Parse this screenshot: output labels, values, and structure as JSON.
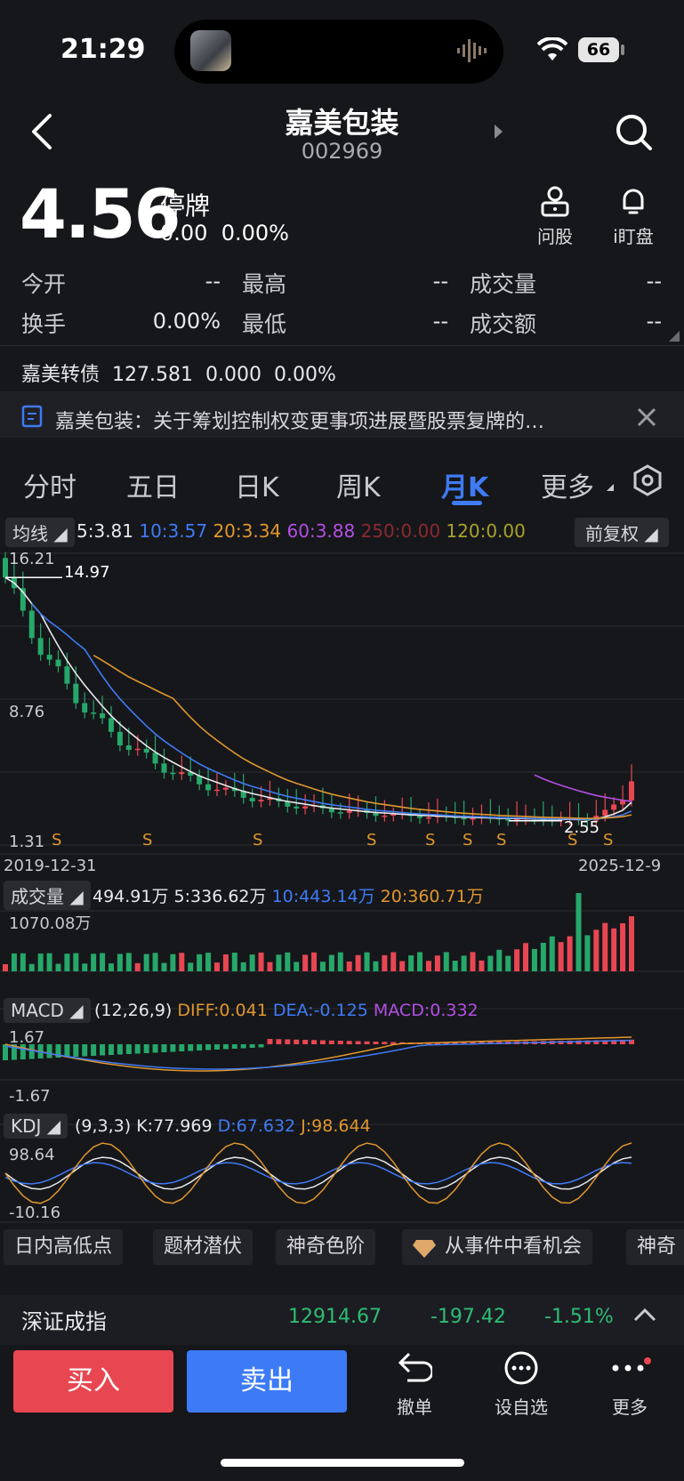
{
  "status": {
    "time": "21:29",
    "battery": "66"
  },
  "header": {
    "title": "嘉美包装",
    "code": "002969"
  },
  "quote": {
    "price": "4.56",
    "status": "停牌",
    "change": "0.00",
    "change_pct": "0.00%"
  },
  "tools": {
    "ask": "问股",
    "watch": "i盯盘"
  },
  "stats": {
    "open_label": "今开",
    "open": "--",
    "high_label": "最高",
    "high": "--",
    "vol_label": "成交量",
    "vol": "--",
    "turnover_label": "换手",
    "turnover": "0.00%",
    "low_label": "最低",
    "low": "--",
    "amount_label": "成交额",
    "amount": "--"
  },
  "bond": {
    "name": "嘉美转债",
    "price": "127.581",
    "change": "0.000",
    "pct": "0.00%"
  },
  "notice": {
    "text": "嘉美包装：关于筹划控制权变更事项进展暨股票复牌的…"
  },
  "tabs": [
    "分时",
    "五日",
    "日K",
    "周K",
    "月K",
    "更多"
  ],
  "active_tab": "月K",
  "ma": {
    "pill": "均线",
    "ma5": "5:3.81",
    "ma10": "10:3.57",
    "ma20": "20:3.34",
    "ma60": "60:3.88",
    "ma250": "250:0.00",
    "ma120": "120:0.00",
    "adjust": "前复权"
  },
  "price_axis": {
    "top": "16.21",
    "mid": "8.76",
    "bottom": "1.31",
    "max_mark": "14.97",
    "min_mark": "2.55",
    "start_date": "2019-12-31",
    "end_date": "2025-12-9",
    "s_mark": "S"
  },
  "volume": {
    "pill": "成交量",
    "value": "494.91万",
    "ma5": "5:336.62万",
    "ma10": "10:443.14万",
    "ma20": "20:360.71万",
    "max": "1070.08万"
  },
  "macd": {
    "pill": "MACD",
    "params": "(12,26,9)",
    "diff": "DIFF:0.041",
    "dea": "DEA:-0.125",
    "macd": "MACD:0.332",
    "top": "1.67",
    "bottom": "-1.67"
  },
  "kdj": {
    "pill": "KDJ",
    "params": "(9,3,3)",
    "k": "K:77.969",
    "d": "D:67.632",
    "j": "J:98.644",
    "top": "98.64",
    "bottom": "-10.16"
  },
  "chips": [
    "日内高低点",
    "题材潜伏",
    "神奇色阶",
    "从事件中看机会",
    "神奇"
  ],
  "index": {
    "name": "深证成指",
    "value": "12914.67",
    "change": "-197.42",
    "pct": "-1.51%"
  },
  "actions": {
    "buy": "买入",
    "sell": "卖出",
    "cancel": "撤单",
    "watchlist": "设自选",
    "more": "更多"
  },
  "colors": {
    "up": "#e84752",
    "down": "#26a86a",
    "blue": "#3f7bf5",
    "orange": "#e0972d",
    "purple": "#b24fe3"
  },
  "chart_data": {
    "type": "candlestick",
    "period": "monthly",
    "x_range": [
      "2019-12-31",
      "2025-12-9"
    ],
    "ylim": [
      1.31,
      16.21
    ],
    "max_label": 14.97,
    "min_label": 2.55,
    "last_close": 4.56,
    "ma": {
      "5": 3.81,
      "10": 3.57,
      "20": 3.34,
      "60": 3.88
    },
    "volume_max": "1070.08万",
    "macd": {
      "diff": 0.041,
      "dea": -0.125,
      "macd": 0.332,
      "ylim": [
        -1.67,
        1.67
      ]
    },
    "kdj": {
      "k": 77.969,
      "d": 67.632,
      "j": 98.644,
      "ylim": [
        -10.16,
        98.64
      ]
    }
  }
}
